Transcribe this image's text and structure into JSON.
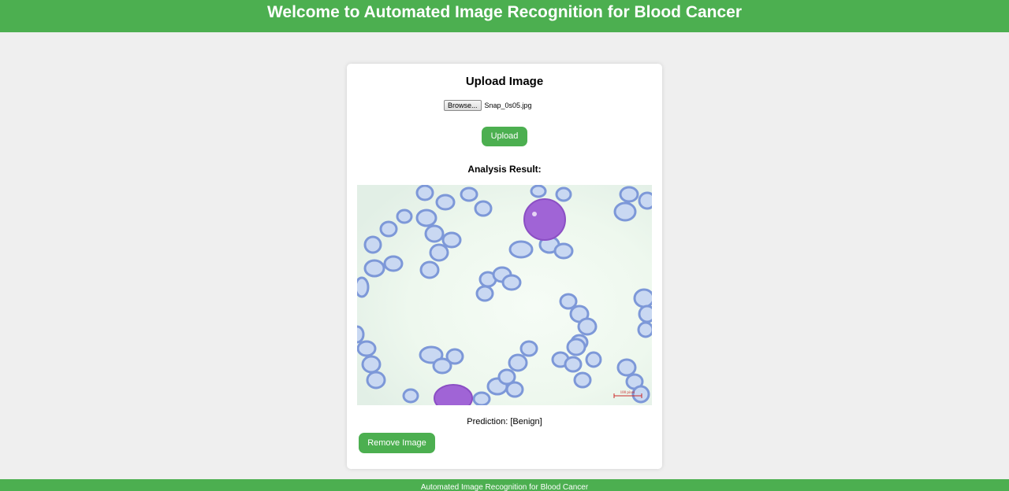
{
  "header": {
    "title": "Welcome to Automated Image Recognition for Blood Cancer"
  },
  "upload_card": {
    "title": "Upload Image",
    "browse_label": "Browse...",
    "file_name": "Snap_0s05.jpg",
    "upload_label": "Upload",
    "result_label": "Analysis Result:",
    "scale_bar_text": "100 pixel",
    "prediction": "Prediction: [Benign]",
    "remove_label": "Remove Image"
  },
  "colors": {
    "accent": "#4caf50",
    "page_background": "#efefef",
    "rbc": "#7d98d8",
    "blast": "#9b5fd1"
  },
  "footer": {
    "text": "Automated Image Recognition for Blood Cancer"
  }
}
